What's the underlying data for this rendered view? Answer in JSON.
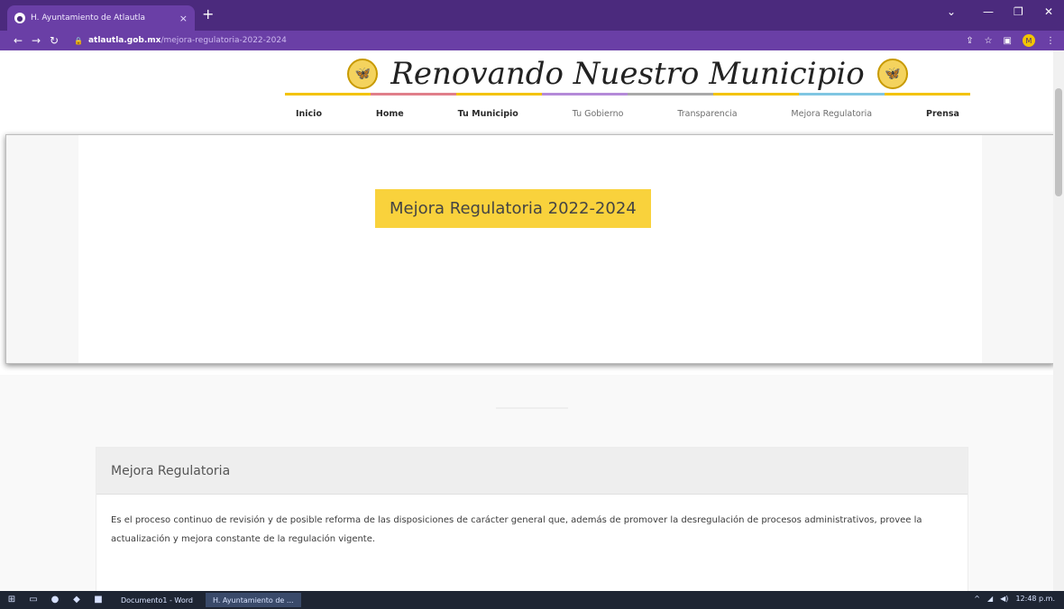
{
  "browser": {
    "tab_title": "H. Ayuntamiento de Atlautla",
    "tab_close": "×",
    "new_tab": "+",
    "url_domain": "atlautla.gob.mx",
    "url_path": "/mejora-regulatoria-2022-2024",
    "controls": {
      "minimize": "—",
      "maximize": "❐",
      "close": "✕",
      "chevron": "⌄"
    },
    "nav": {
      "back": "←",
      "forward": "→",
      "reload": "↻"
    },
    "profile_initial": "M"
  },
  "site": {
    "logo_text": "Renovando Nuestro Municipio",
    "emblem_glyph": "🦋",
    "rainbow_colors": [
      "#f3c300",
      "#e07e8a",
      "#f3c300",
      "#b48ad8",
      "#a9a9a9",
      "#f3c300",
      "#7fc6e2",
      "#f3c300"
    ],
    "nav_items": [
      {
        "label": "Inicio",
        "bold": true
      },
      {
        "label": "Home",
        "bold": true
      },
      {
        "label": "Tu Municipio",
        "bold": true
      },
      {
        "label": "Tu Gobierno",
        "bold": false
      },
      {
        "label": "Transparencia",
        "bold": false
      },
      {
        "label": "Mejora Regulatoria",
        "bold": false
      },
      {
        "label": "Prensa",
        "bold": true
      }
    ]
  },
  "hero": {
    "banner_text": "Mejora Regulatoria 2022-2024",
    "banner_color": "#f9d23c"
  },
  "card": {
    "title": "Mejora Regulatoria",
    "body": "Es el proceso continuo de revisión y de posible reforma de las disposiciones de carácter general que, además de promover la desregulación de procesos administrativos, provee la actualización y mejora constante de la regulación vigente."
  },
  "taskbar": {
    "apps": [
      {
        "label": "Documento1 - Word",
        "active": false
      },
      {
        "label": "H. Ayuntamiento de ...",
        "active": true
      }
    ],
    "time": "12:48 p.m."
  }
}
